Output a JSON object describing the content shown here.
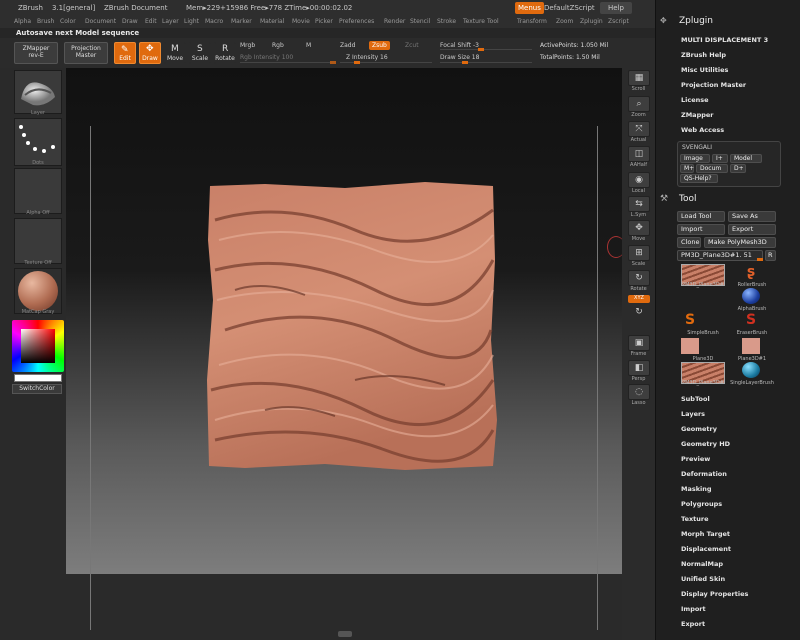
{
  "titlebar": {
    "app": "ZBrush",
    "version": "3.1[general]",
    "document": "ZBrush Document",
    "mem": "Mem▸229+15986 Free▸778 ZTime▸00:00:02.02",
    "menus_button": "Menus",
    "script": "DefaultZScript",
    "help": "Help"
  },
  "menubar": [
    "Alpha",
    "Brush",
    "Color",
    "Document",
    "Draw",
    "Edit",
    "Layer",
    "Light",
    "Macro",
    "Marker",
    "Material",
    "Movie",
    "Picker",
    "Preferences",
    "Render",
    "Stencil",
    "Stroke",
    "Texture",
    "Tool",
    "Transform",
    "Zoom",
    "Zplugin",
    "Zscript"
  ],
  "notification": "Autosave next Model sequence",
  "toolbar": {
    "zmapper": "ZMapper",
    "zmapper_sub": "rev-E",
    "projection": "Projection",
    "projection_sub": "Master",
    "edit": "Edit",
    "draw": "Draw",
    "move": "Move",
    "scale": "Scale",
    "rotate": "Rotate",
    "mrgb": "Mrgb",
    "rgb": "Rgb",
    "m": "M",
    "rgb_intensity": "Rgb Intensity 100",
    "zadd": "Zadd",
    "zsub": "Zsub",
    "zcut": "Zcut",
    "z_intensity": "Z Intensity 16",
    "focal_shift": "Focal Shift -3",
    "draw_size": "Draw Size 18",
    "active_points": "ActivePoints: 1.050 Mil",
    "total_points": "TotalPoints: 1.50 Mil"
  },
  "left_shelf": {
    "layer": "Layer",
    "dots": "Dots",
    "alpha": "Alpha Off",
    "texture": "Texture Off",
    "matcap": "MatCap Gray",
    "switch_color": "SwitchColor"
  },
  "right_strip": [
    "Scroll",
    "Zoom",
    "Actual",
    "AAHalf",
    "Local",
    "L.Sym",
    "Move",
    "Scale",
    "Rotate",
    "XYZ",
    "",
    "Frame",
    "Persp",
    "Lasso"
  ],
  "zplugin": {
    "title": "Zplugin",
    "items": [
      "MULTI DISPLACEMENT 3",
      "ZBrush Help",
      "Misc Utilities",
      "Projection Master",
      "License",
      "ZMapper",
      "Web Access"
    ],
    "svengali": {
      "title": "SVENGALI",
      "image": "Image",
      "iplus": "I+",
      "model": "Model",
      "mplus": "M+",
      "docum": "Docum",
      "dplus": "D+",
      "qs": "QS-Help?"
    }
  },
  "tool": {
    "title": "Tool",
    "load_tool": "Load Tool",
    "save_as": "Save As",
    "import": "Import",
    "export": "Export",
    "clone": "Clone",
    "make_polymesh": "Make PolyMesh3D",
    "current": "PM3D_Plane3D#1. 51",
    "r": "R",
    "thumbs": [
      "PM3D_Plane3D#",
      "RollerBrush",
      "",
      "AlphaBrush",
      "SimpleBrush",
      "EraserBrush",
      "Plane3D",
      "Plane3D#1",
      "PM3D_Plane3D#",
      "SingleLayerBrush"
    ],
    "subpalettes": [
      "SubTool",
      "Layers",
      "Geometry",
      "Geometry HD",
      "Preview",
      "Deformation",
      "Masking",
      "Polygroups",
      "Texture",
      "Morph Target",
      "Displacement",
      "NormalMap",
      "Unified Skin",
      "Display Properties",
      "Import",
      "Export"
    ]
  },
  "colors": {
    "accent": "#e06a0e",
    "clay": "#c98068",
    "panel": "#1f1f1f"
  }
}
